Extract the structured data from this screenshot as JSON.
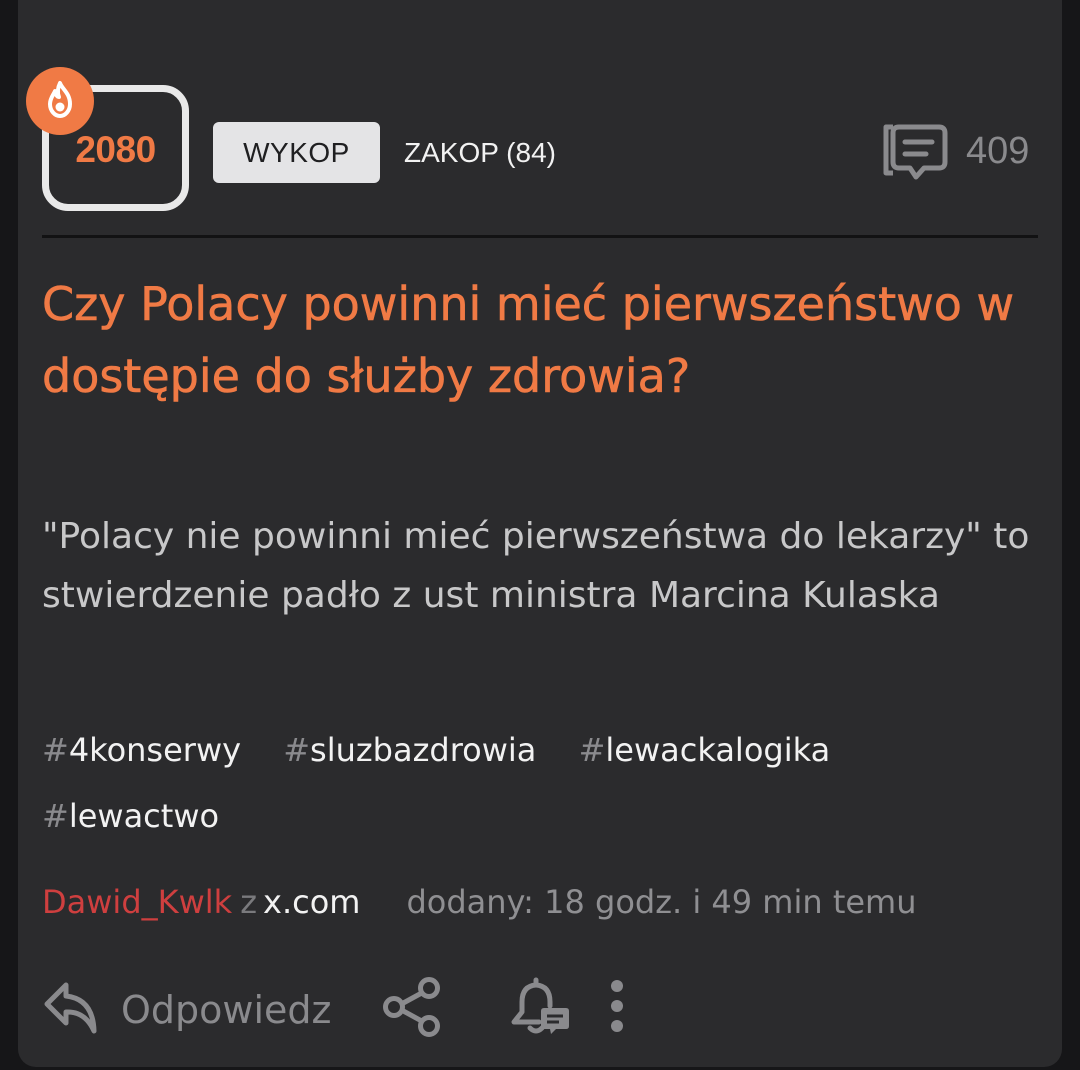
{
  "entry": {
    "votes": "2080",
    "hot_badge_icon": "flame-icon",
    "upvote_label": "WYKOP",
    "downvote_label": "ZAKOP (84)",
    "comments_icon": "comments-icon",
    "comments_count": "409",
    "title": "Czy Polacy powinni mieć pierwszeństwo w dostępie do służby zdrowia?",
    "description": "\"Polacy nie powinni mieć pierwszeństwa do lekarzy\" to stwierdzenie padło z ust ministra Marcina Kulaska",
    "tags": [
      {
        "hash": "#",
        "name": "4konserwy"
      },
      {
        "hash": "#",
        "name": "sluzbazdrowia"
      },
      {
        "hash": "#",
        "name": "lewackalogika"
      },
      {
        "hash": "#",
        "name": "lewactwo"
      }
    ],
    "author": "Dawid_Kwlk",
    "from_word": "z",
    "source": "x.com",
    "added": "dodany: 18 godz. i 49 min temu"
  },
  "actions": {
    "reply_label": "Odpowiedz",
    "reply_icon": "reply-icon",
    "share_icon": "share-icon",
    "observe_icon": "bell-icon",
    "more_icon": "more-vertical-icon"
  },
  "colors": {
    "accent": "#f07a45",
    "author": "#cf3f3f",
    "card_background": "#2b2b2d",
    "page_background": "#161618",
    "muted_text": "#8a8a8d"
  }
}
